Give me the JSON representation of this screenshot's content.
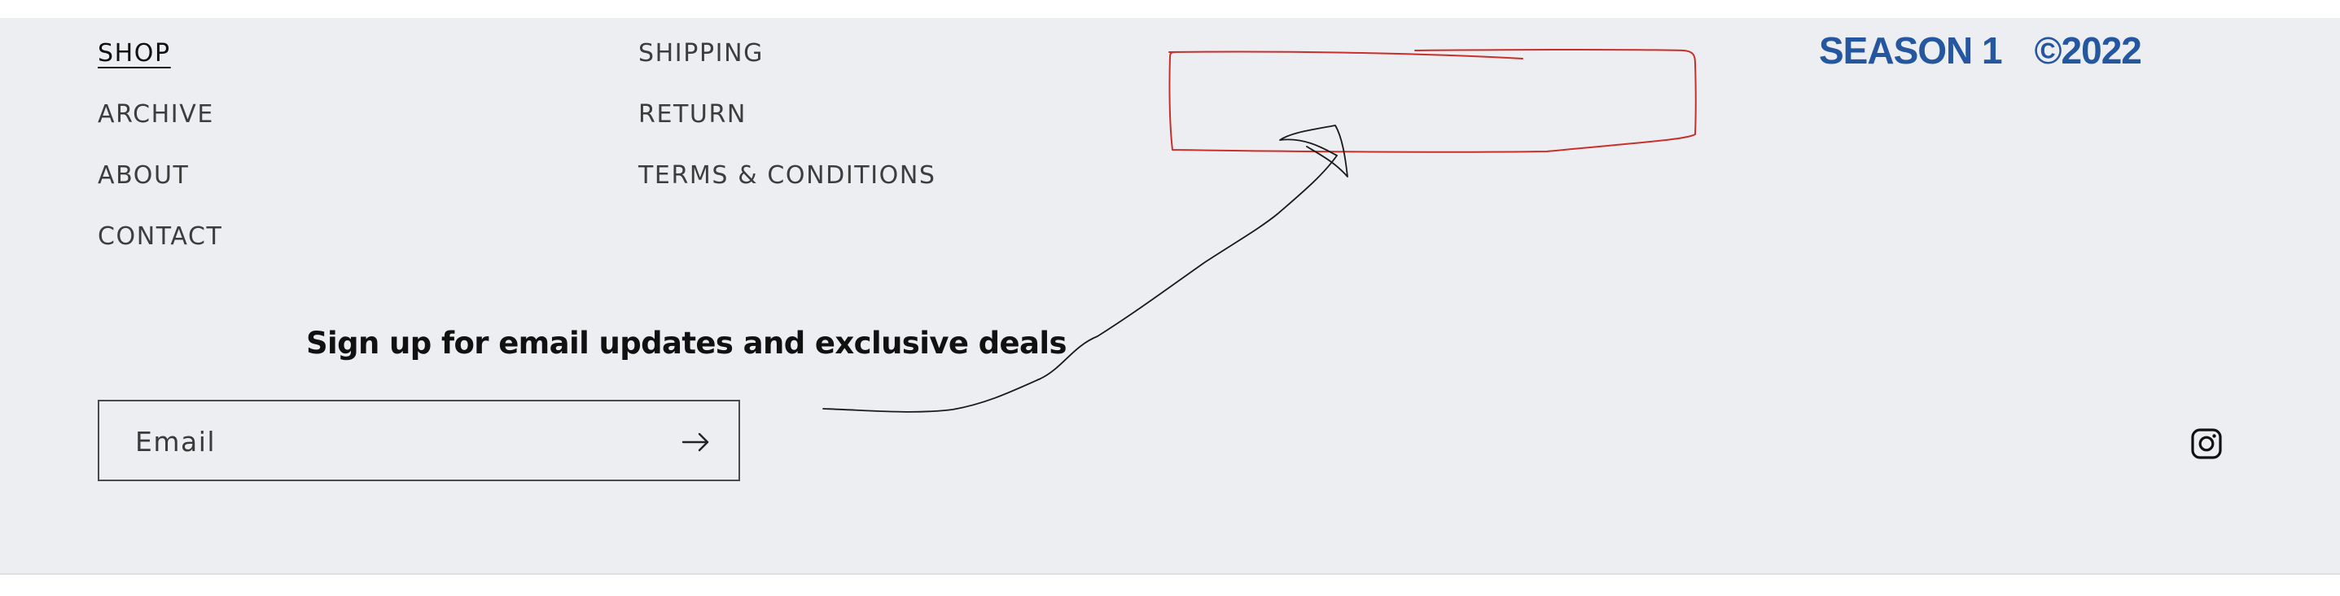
{
  "footer": {
    "shop_links": [
      {
        "label": "SHOP",
        "active": true
      },
      {
        "label": "ARCHIVE",
        "active": false
      },
      {
        "label": "ABOUT",
        "active": false
      },
      {
        "label": "CONTACT",
        "active": false
      }
    ],
    "policy_links": [
      {
        "label": "SHIPPING"
      },
      {
        "label": "RETURN"
      },
      {
        "label": "TERMS & CONDITIONS"
      }
    ],
    "season": {
      "label": "SEASON 1",
      "copyright": "©2022",
      "color": "#24579f"
    },
    "newsletter": {
      "heading": "Sign up for email updates and exclusive deals",
      "email_placeholder": "Email",
      "email_value": "",
      "submit_icon": "arrow-right-icon"
    },
    "social": {
      "icon": "instagram-icon"
    }
  },
  "annotation": {
    "box_color": "#c9302c",
    "arrow_color": "#1a1a1a"
  },
  "colors": {
    "footer_background": "#eceef2",
    "text": "#3d3d3d"
  }
}
